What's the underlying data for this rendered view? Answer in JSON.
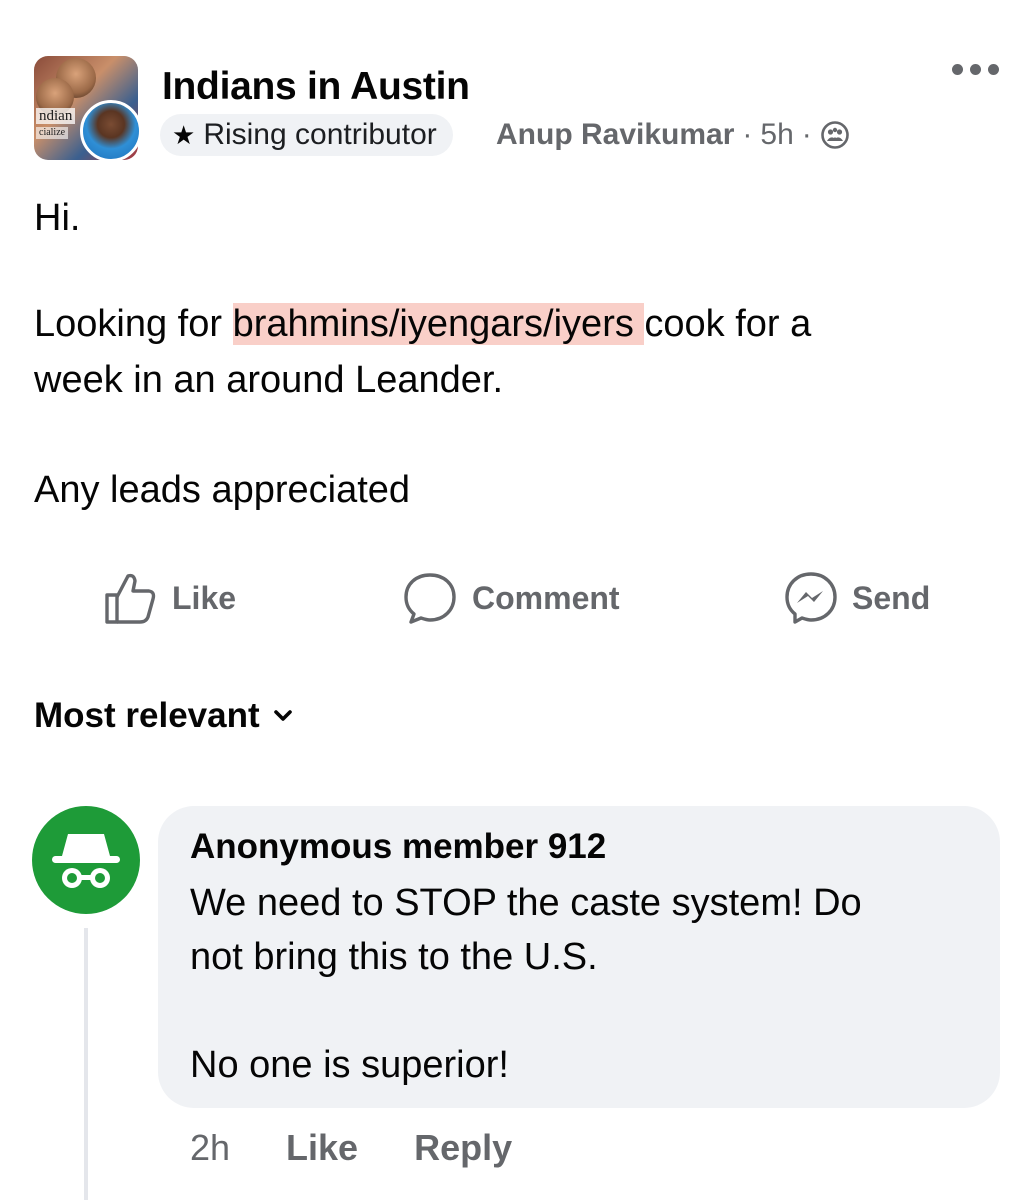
{
  "post": {
    "group_name": "Indians in Austin",
    "group_logo_text": "ndian",
    "group_logo_subtext": "cialize",
    "badge_label": "Rising contributor",
    "author": "Anup Ravikumar",
    "separator": "·",
    "time": "5h",
    "audience_icon": "group-audience-icon",
    "line1": "Hi.",
    "line2_before": "Looking for ",
    "line2_highlight": "brahmins/iyengars/iyers ",
    "line2_after": "cook for a",
    "line3": "week in an around Leander.",
    "line4": "Any leads appreciated"
  },
  "actions": {
    "like": "Like",
    "comment": "Comment",
    "send": "Send"
  },
  "comments_sort": {
    "label": "Most relevant"
  },
  "comment": {
    "author": "Anonymous member 912",
    "line1": "We need to STOP the caste system! Do",
    "line2": "not bring this to the U.S.",
    "line3": "No one is superior!",
    "time": "2h",
    "like": "Like",
    "reply": "Reply"
  },
  "colors": {
    "highlight": "#f9cfc8",
    "anon_avatar": "#1e9b38",
    "secondary_text": "#65676b",
    "bubble": "#f0f2f5"
  }
}
